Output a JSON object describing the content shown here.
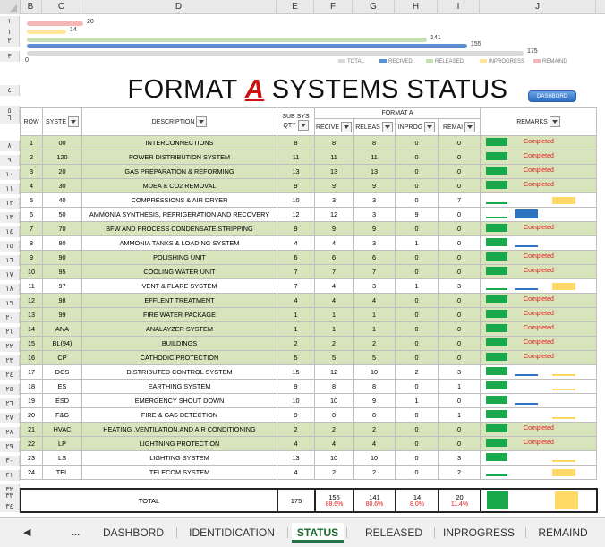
{
  "column_headers": [
    "B",
    "C",
    "D",
    "E",
    "F",
    "G",
    "H",
    "I",
    "J"
  ],
  "row_numbers": [
    "١",
    "١",
    "٢",
    "٣",
    "٤",
    "٥",
    "٦",
    "٨",
    "٩",
    "١٠",
    "١١",
    "١٢",
    "١٣",
    "١٤",
    "١٥",
    "١٦",
    "١٧",
    "١٨",
    "١٩",
    "٢٠",
    "٢١",
    "٢٢",
    "٢٣",
    "٢٤",
    "٢٥",
    "٢٦",
    "٢٧",
    "٢٨",
    "٢٩",
    "٣٠",
    "٣١",
    "٣٢",
    "٣٣",
    "٣٤"
  ],
  "chart_data": {
    "type": "bar",
    "series": [
      {
        "name": "REMAIND",
        "value": 20,
        "color": "#f4b6b6"
      },
      {
        "name": "INPROGRESS",
        "value": 14,
        "color": "#ffe699"
      },
      {
        "name": "RELEASED",
        "value": 141,
        "color": "#c6e0b4"
      },
      {
        "name": "RECIVED",
        "value": 155,
        "color": "#5b8fd6"
      },
      {
        "name": "TOTAL",
        "value": 175,
        "color": "#d9d9d9"
      }
    ],
    "axis_start_label": "0",
    "legend": [
      "TOTAL",
      "RECIVED",
      "RELEASED",
      "INPROGRESS",
      "REMAIND"
    ],
    "legend_colors": [
      "#d9d9d9",
      "#5b8fd6",
      "#c6e0b4",
      "#ffe699",
      "#f4b6b6"
    ],
    "xlim": [
      0,
      175
    ]
  },
  "title": {
    "prefix": "FORMAT ",
    "accent": "A",
    "suffix": "  SYSTEMS STATUS"
  },
  "dashboard_button": "DASHBORD",
  "table_header": {
    "row": "ROW",
    "system": "SYSTE",
    "description": "DESCRIPTION",
    "sub_sys_1": "SUB SYS",
    "sub_sys_2": "QTY",
    "group": "FORMAT A",
    "received": "RECIVE",
    "released": "RELEAS",
    "inprog": "INPROG",
    "remain": "REMAI",
    "remarks": "REMARKS"
  },
  "rows": [
    {
      "row": "1",
      "sys": "00",
      "desc": "INTERCONNECTIONS",
      "qty": "8",
      "rec": "8",
      "rel": "8",
      "inp": "0",
      "rem": "0",
      "remark": "Completed"
    },
    {
      "row": "2",
      "sys": "120",
      "desc": "POWER DISTRIBUTION SYSTEM",
      "qty": "11",
      "rec": "11",
      "rel": "11",
      "inp": "0",
      "rem": "0",
      "remark": "Completed"
    },
    {
      "row": "3",
      "sys": "20",
      "desc": "GAS PREPARATION & REFORMING",
      "qty": "13",
      "rec": "13",
      "rel": "13",
      "inp": "0",
      "rem": "0",
      "remark": "Completed"
    },
    {
      "row": "4",
      "sys": "30",
      "desc": "MDEA & CO2 REMOVAL",
      "qty": "9",
      "rec": "9",
      "rel": "9",
      "inp": "0",
      "rem": "0",
      "remark": "Completed"
    },
    {
      "row": "5",
      "sys": "40",
      "desc": "COMPRESSIONS & AIR DRYER",
      "qty": "10",
      "rec": "3",
      "rel": "3",
      "inp": "0",
      "rem": "7",
      "remark": ""
    },
    {
      "row": "6",
      "sys": "50",
      "desc": "AMMONIA SYNTHESIS, REFRIGERATION AND RECOVERY",
      "qty": "12",
      "rec": "12",
      "rel": "3",
      "inp": "9",
      "rem": "0",
      "remark": ""
    },
    {
      "row": "7",
      "sys": "70",
      "desc": "BFW AND PROCESS CONDENSATE STRIPPING",
      "qty": "9",
      "rec": "9",
      "rel": "9",
      "inp": "0",
      "rem": "0",
      "remark": "Completed"
    },
    {
      "row": "8",
      "sys": "80",
      "desc": "AMMONIA TANKS & LOADING SYSTEM",
      "qty": "4",
      "rec": "4",
      "rel": "3",
      "inp": "1",
      "rem": "0",
      "remark": ""
    },
    {
      "row": "9",
      "sys": "90",
      "desc": "POLISHING UNIT",
      "qty": "6",
      "rec": "6",
      "rel": "6",
      "inp": "0",
      "rem": "0",
      "remark": "Completed"
    },
    {
      "row": "10",
      "sys": "95",
      "desc": "COOLING WATER UNIT",
      "qty": "7",
      "rec": "7",
      "rel": "7",
      "inp": "0",
      "rem": "0",
      "remark": "Completed"
    },
    {
      "row": "11",
      "sys": "97",
      "desc": "VENT & FLARE SYSTEM",
      "qty": "7",
      "rec": "4",
      "rel": "3",
      "inp": "1",
      "rem": "3",
      "remark": ""
    },
    {
      "row": "12",
      "sys": "98",
      "desc": "EFFLENT TREATMENT",
      "qty": "4",
      "rec": "4",
      "rel": "4",
      "inp": "0",
      "rem": "0",
      "remark": "Completed"
    },
    {
      "row": "13",
      "sys": "99",
      "desc": "FIRE WATER PACKAGE",
      "qty": "1",
      "rec": "1",
      "rel": "1",
      "inp": "0",
      "rem": "0",
      "remark": "Completed"
    },
    {
      "row": "14",
      "sys": "ANA",
      "desc": "ANALAYZER SYSTEM",
      "qty": "1",
      "rec": "1",
      "rel": "1",
      "inp": "0",
      "rem": "0",
      "remark": "Completed"
    },
    {
      "row": "15",
      "sys": "BL(94)",
      "desc": "BUILDINGS",
      "qty": "2",
      "rec": "2",
      "rel": "2",
      "inp": "0",
      "rem": "0",
      "remark": "Completed"
    },
    {
      "row": "16",
      "sys": "CP",
      "desc": "CATHODIC PROTECTION",
      "qty": "5",
      "rec": "5",
      "rel": "5",
      "inp": "0",
      "rem": "0",
      "remark": "Completed"
    },
    {
      "row": "17",
      "sys": "DCS",
      "desc": "DISTRIBUTED CONTROL SYSTEM",
      "qty": "15",
      "rec": "12",
      "rel": "10",
      "inp": "2",
      "rem": "3",
      "remark": ""
    },
    {
      "row": "18",
      "sys": "ES",
      "desc": "EARTHING SYSTEM",
      "qty": "9",
      "rec": "8",
      "rel": "8",
      "inp": "0",
      "rem": "1",
      "remark": ""
    },
    {
      "row": "19",
      "sys": "ESD",
      "desc": "EMERGENCY SHOUT DOWN",
      "qty": "10",
      "rec": "10",
      "rel": "9",
      "inp": "1",
      "rem": "0",
      "remark": ""
    },
    {
      "row": "20",
      "sys": "F&G",
      "desc": "FIRE & GAS DETECTION",
      "qty": "9",
      "rec": "8",
      "rel": "8",
      "inp": "0",
      "rem": "1",
      "remark": ""
    },
    {
      "row": "21",
      "sys": "HVAC",
      "desc": "HEATING ,VENTILATION,AND AIR CONDITIONING",
      "qty": "2",
      "rec": "2",
      "rel": "2",
      "inp": "0",
      "rem": "0",
      "remark": "Completed"
    },
    {
      "row": "22",
      "sys": "LP",
      "desc": "LIGHTNING PROTECTION",
      "qty": "4",
      "rec": "4",
      "rel": "4",
      "inp": "0",
      "rem": "0",
      "remark": "Completed"
    },
    {
      "row": "23",
      "sys": "LS",
      "desc": "LIGHTING SYSTEM",
      "qty": "13",
      "rec": "10",
      "rel": "10",
      "inp": "0",
      "rem": "3",
      "remark": ""
    },
    {
      "row": "24",
      "sys": "TEL",
      "desc": "TELECOM SYSTEM",
      "qty": "4",
      "rec": "2",
      "rel": "2",
      "inp": "0",
      "rem": "2",
      "remark": ""
    }
  ],
  "totals": {
    "label": "TOTAL",
    "qty": "175",
    "rec": "155",
    "rec_pct": "88.6%",
    "rel": "141",
    "rel_pct": "80.6%",
    "inp": "14",
    "inp_pct": "8.0%",
    "rem": "20",
    "rem_pct": "11.4%"
  },
  "sheet_tabs": {
    "ellipsis": "...",
    "items": [
      "DASHBORD",
      "IDENTIDICATION",
      "STATUS",
      "RELEASED",
      "INPROGRESS",
      "REMAIND"
    ],
    "active": "STATUS"
  }
}
